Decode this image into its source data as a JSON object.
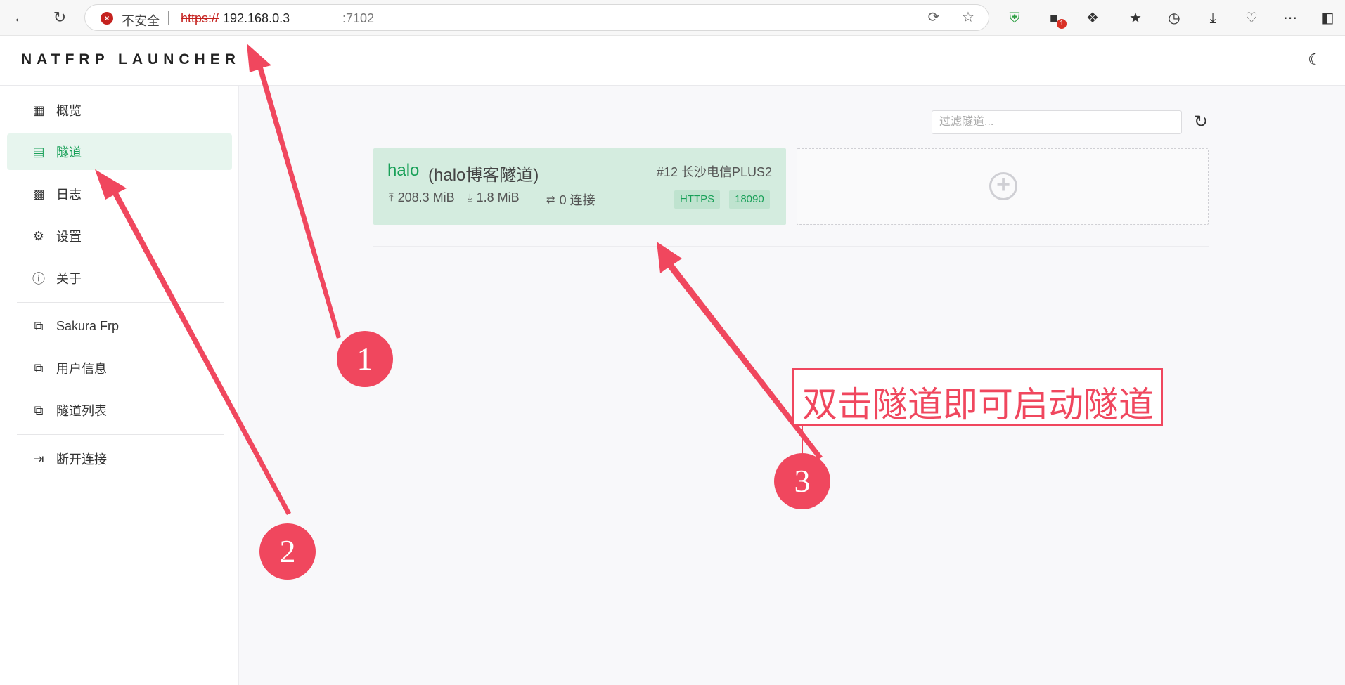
{
  "browser": {
    "security_label": "不安全",
    "url_scheme": "https://",
    "url_host": "192.168.0.3",
    "url_port": ":7102",
    "extension_badge": "1",
    "icons": [
      "back-icon",
      "reload-icon",
      "reader-icon",
      "favorite-icon",
      "shield-icon",
      "extension-icon",
      "puzzle-icon",
      "favorites-icon",
      "history-icon",
      "download-icon",
      "heart-icon",
      "more-icon",
      "sidebar-icon"
    ]
  },
  "app": {
    "title": "NATFRP LAUNCHER",
    "theme_icon": "moon-icon"
  },
  "sidebar": {
    "items": [
      {
        "label": "概览",
        "icon": "dashboard-icon",
        "active": false
      },
      {
        "label": "隧道",
        "icon": "tunnel-icon",
        "active": true
      },
      {
        "label": "日志",
        "icon": "log-icon",
        "active": false
      },
      {
        "label": "设置",
        "icon": "gear-icon",
        "active": false
      },
      {
        "label": "关于",
        "icon": "info-icon",
        "active": false
      }
    ],
    "links": [
      {
        "label": "Sakura Frp",
        "icon": "external-link-icon"
      },
      {
        "label": "用户信息",
        "icon": "external-link-icon"
      },
      {
        "label": "隧道列表",
        "icon": "external-link-icon"
      }
    ],
    "disconnect": {
      "label": "断开连接",
      "icon": "logout-icon"
    }
  },
  "main": {
    "filter_placeholder": "过滤隧道...",
    "tunnel": {
      "name": "halo",
      "description": "(halo博客隧道)",
      "node": "#12 长沙电信PLUS2",
      "upload": "208.3 MiB",
      "download": "1.8 MiB",
      "connections": "0 连接",
      "type_tag": "HTTPS",
      "port_tag": "18090"
    }
  },
  "annotations": {
    "marker_1": "1",
    "marker_2": "2",
    "marker_3": "3",
    "callout": "双击隧道即可启动隧道",
    "color": "#f0475e"
  },
  "colors": {
    "accent": "#18a058",
    "card_bg": "#d4ecdf",
    "annotation": "#f0475e"
  }
}
